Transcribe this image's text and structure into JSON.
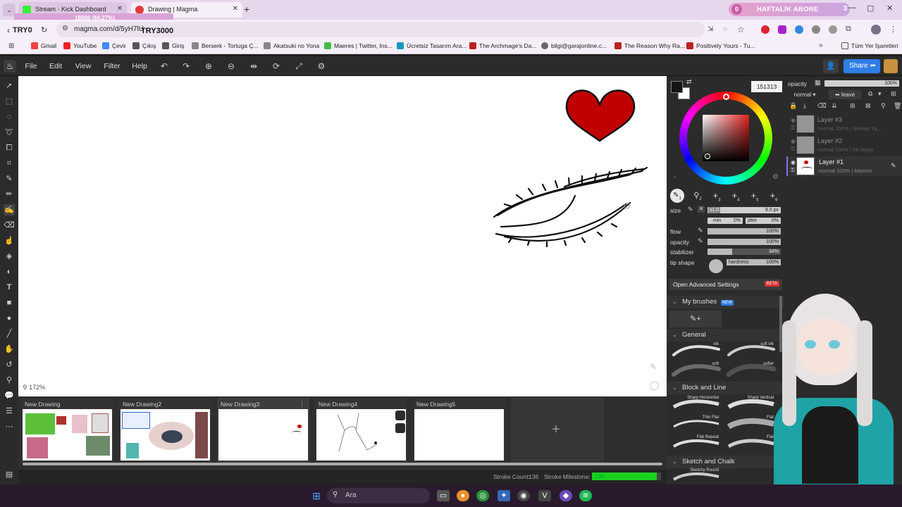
{
  "browser": {
    "tabs": [
      {
        "title": "Stream - Kick Dashboard",
        "active": false
      },
      {
        "title": "Drawing | Magma",
        "active": true
      }
    ],
    "overlay_progress": "18086 (60.27%)",
    "overlay_left_text": "TRY0",
    "overlay_code": "TRY3000",
    "url": "magma.com/d/5yH7lU",
    "banner": {
      "text": "HAFTALIK ABONE",
      "left_num": "0",
      "right_num": "3"
    },
    "bookmarks": [
      "Gmail",
      "YouTube",
      "Çevir",
      "Çıkış",
      "Giriş",
      "Berserk - Tortuga Ç...",
      "Akatsuki no Yona",
      "Maeres | Twitter, Ins...",
      "Ücretsiz Tasarım Ara...",
      "The Archmage's Da...",
      "bilgi@garajonline.c...",
      "The Reason Why Ra...",
      "Positively Yours - Tu..."
    ],
    "bookmarks_folder": "Tüm Yer İşaretleri"
  },
  "menu": {
    "file": "File",
    "edit": "Edit",
    "view": "View",
    "filter": "Filter",
    "help": "Help",
    "share": "Share"
  },
  "canvas": {
    "zoom": "172%"
  },
  "docs": [
    {
      "title": "New Drawing"
    },
    {
      "title": "New Drawing2"
    },
    {
      "title": "New Drawing3"
    },
    {
      "title": "New Drawing4"
    },
    {
      "title": "New Drawing5"
    }
  ],
  "status": {
    "stroke_count_label": "Stroke Count:",
    "stroke_count": "136",
    "milestone_label": "Stroke Milestone:",
    "milestone_value": "136",
    "milestone_fraction": 0.94
  },
  "color": {
    "hex": "151313",
    "primary": "#151313",
    "secondary": "#ffffff"
  },
  "brush": {
    "size_label": "size",
    "size_value": "9.0 px",
    "size_mult": "x1.0",
    "min_label": "min",
    "min_value": "0%",
    "jitter_label": "jitter",
    "jitter_value": "0%",
    "flow_label": "flow",
    "flow_value": "100%",
    "flow_fraction": 1.0,
    "opacity_label": "opacity",
    "opacity_value": "100%",
    "opacity_fraction": 1.0,
    "stabilizer_label": "stabilizer",
    "stabilizer_value": "34%",
    "stabilizer_fraction": 0.34,
    "tip_label": "tip shape",
    "hardness_label": "hardness",
    "hardness_value": "100%",
    "hardness_fraction": 1.0,
    "slots": [
      "1",
      "2",
      "3",
      "4",
      "5",
      "6"
    ]
  },
  "advanced": {
    "label": "Open Advanced Settings",
    "badge": "BETA"
  },
  "sections": {
    "my_brushes": "My brushes",
    "new_badge": "NEW",
    "general": "General",
    "block_line": "Block and Line",
    "sketch": "Sketch and Chalk"
  },
  "brushes": {
    "general": [
      "ink",
      "soft ink",
      "soft",
      "softer"
    ],
    "block": [
      "Sharp Horizontal",
      "Sharp Vertical",
      "Thin Flat",
      "Flat",
      "Flat Repeat",
      "Flat"
    ],
    "sketch": [
      "Sketchy Round"
    ]
  },
  "layers_panel": {
    "opacity_label": "opacity",
    "opacity_value": "100%",
    "blend": "normal",
    "leave": "leave",
    "layers": [
      {
        "name": "Layer #3",
        "info": "normal 100% | Serkay Ya...",
        "selected": false
      },
      {
        "name": "Layer #2",
        "info": "normal 100% | Mr.Mypo",
        "selected": false
      },
      {
        "name": "Layer #1",
        "info": "normal 100% | Maeres",
        "selected": true
      }
    ]
  },
  "taskbar": {
    "search": "Ara"
  }
}
